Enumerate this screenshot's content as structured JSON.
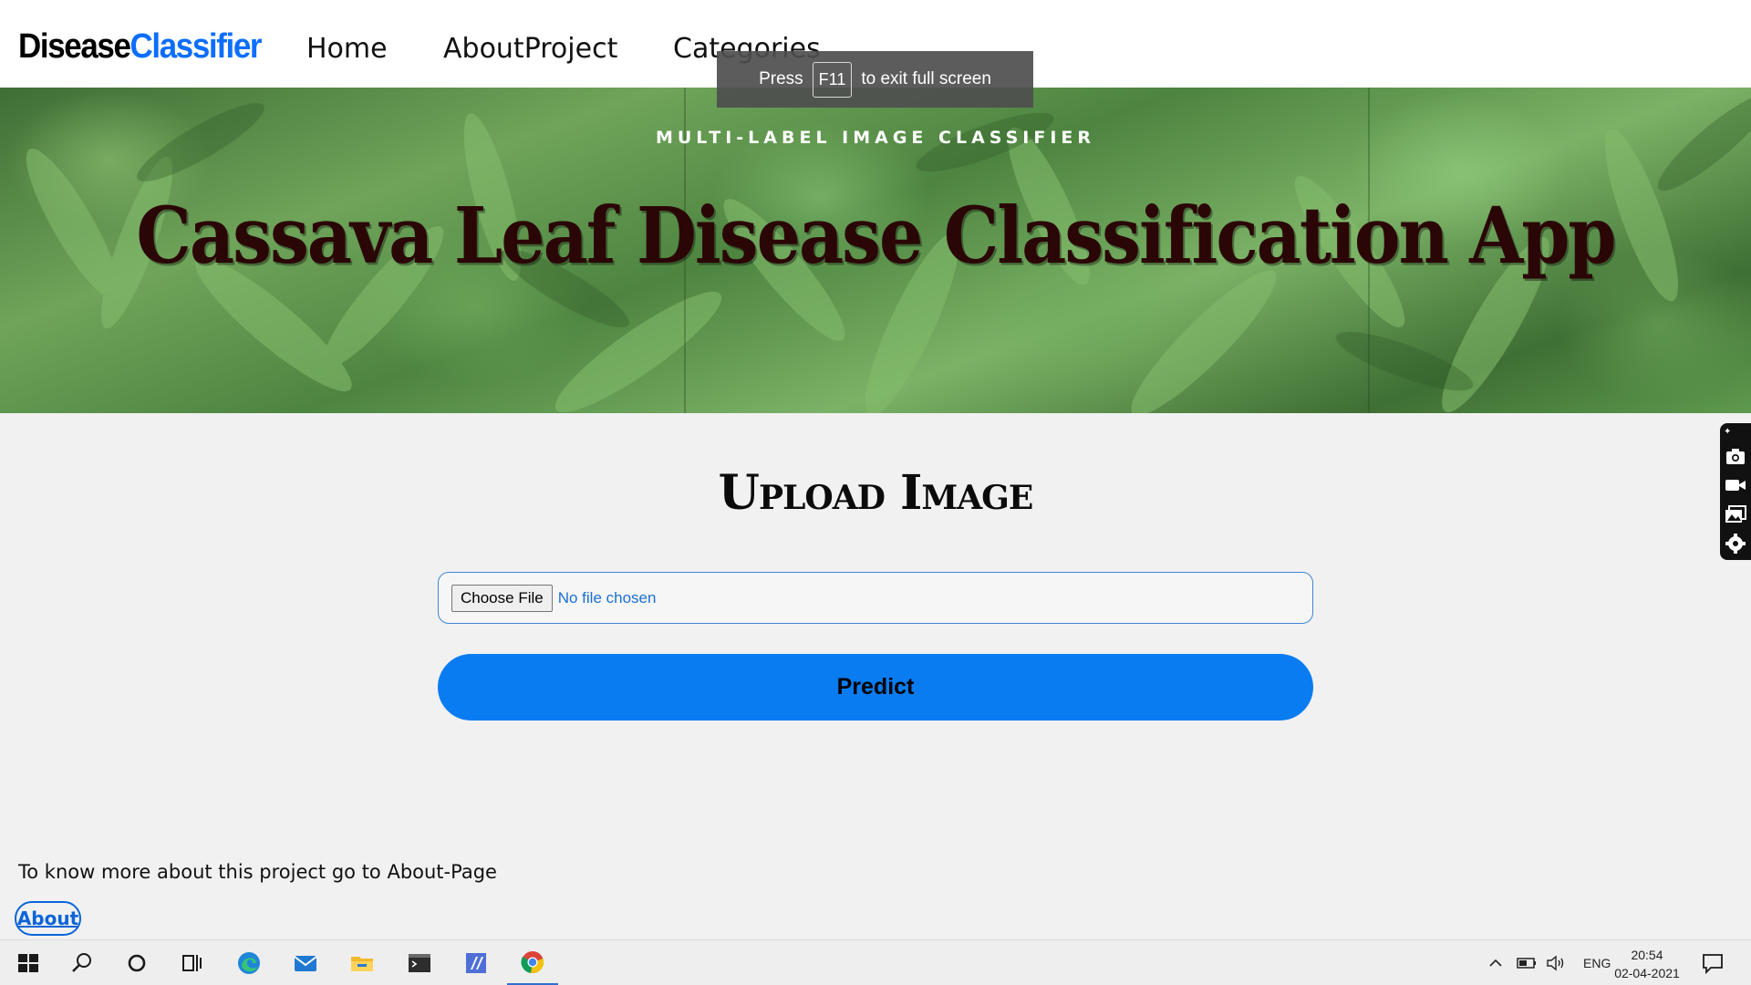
{
  "navbar": {
    "brand_part1": "Disease",
    "brand_part2": "Classifier",
    "links": [
      "Home",
      "AboutProject",
      "Categories"
    ]
  },
  "fullscreen_toast": {
    "pre": "Press",
    "key": "F11",
    "post": "to exit full screen"
  },
  "hero": {
    "subtitle": "MULTI-LABEL IMAGE CLASSIFIER",
    "title": "Cassava Leaf Disease Classification App"
  },
  "upload": {
    "title": "Upload Image",
    "choose_file_label": "Choose File",
    "file_status": "No file chosen",
    "predict_label": "Predict"
  },
  "footer": {
    "info_text": "To know more about this project go to About-Page",
    "about_link": "About"
  },
  "side_widget": {
    "icons": [
      "pin-icon",
      "camera-icon",
      "video-icon",
      "gallery-icon",
      "settings-icon"
    ]
  },
  "taskbar": {
    "icons": [
      "windows-start-icon",
      "search-icon",
      "cortana-icon",
      "task-view-icon",
      "edge-icon",
      "mail-icon",
      "file-explorer-icon",
      "terminal-icon",
      "app-icon",
      "chrome-icon"
    ],
    "tray": {
      "language": "ENG",
      "time": "20:54",
      "date": "02-04-2021"
    }
  },
  "colors": {
    "brand_blue": "#0d6efd",
    "predict_button": "#0a7cf1",
    "hero_title": "#2b0606",
    "link_blue": "#0a64d8"
  }
}
